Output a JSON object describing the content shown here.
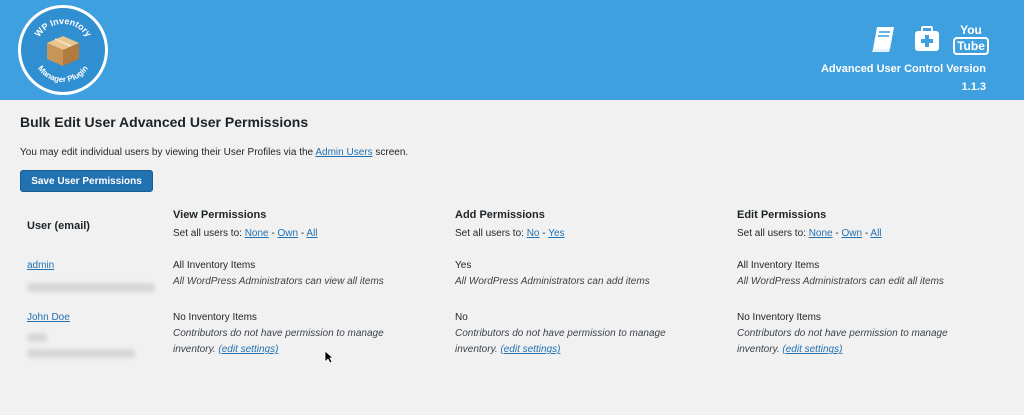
{
  "header": {
    "logo_text": "WP Inventory Manager Plugin",
    "icons": [
      "book-icon",
      "first-aid-kit-icon",
      "youtube-icon"
    ],
    "youtube_label_top": "You",
    "youtube_label_bottom": "Tube",
    "version_line1": "Advanced User Control Version",
    "version_line2": "1.1.3",
    "bg_color": "#3fa0e0"
  },
  "page": {
    "title": "Bulk Edit User Advanced User Permissions",
    "intro_before": "You may edit individual users by viewing their User Profiles via the ",
    "intro_link": "Admin Users",
    "intro_after": " screen.",
    "save_button": "Save User Permissions"
  },
  "table": {
    "user_header": "User (email)",
    "columns": [
      {
        "title": "View Permissions",
        "setall_label": "Set all users to: ",
        "options": [
          "None",
          "Own",
          "All"
        ]
      },
      {
        "title": "Add Permissions",
        "setall_label": "Set all users to: ",
        "options": [
          "No",
          "Yes"
        ]
      },
      {
        "title": "Edit Permissions",
        "setall_label": "Set all users to: ",
        "options": [
          "None",
          "Own",
          "All"
        ]
      }
    ],
    "separator": " - ",
    "rows": [
      {
        "user": "admin",
        "view": {
          "value": "All Inventory Items",
          "desc": "All WordPress Administrators can view all items"
        },
        "add": {
          "value": "Yes",
          "desc": "All WordPress Administrators can add items"
        },
        "edit": {
          "value": "All Inventory Items",
          "desc": "All WordPress Administrators can edit all items"
        }
      },
      {
        "user": "John Doe",
        "view": {
          "value": "No Inventory Items",
          "desc_line1": "Contributors do not have permission to manage",
          "desc_line2": "inventory. ",
          "link": "(edit settings)"
        },
        "add": {
          "value": "No",
          "desc_line1": "Contributors do not have permission to manage",
          "desc_line2": "inventory. ",
          "link": "(edit settings)"
        },
        "edit": {
          "value": "No Inventory Items",
          "desc_line1": "Contributors do not have permission to manage",
          "desc_line2": "inventory. ",
          "link": "(edit settings)"
        }
      }
    ]
  }
}
